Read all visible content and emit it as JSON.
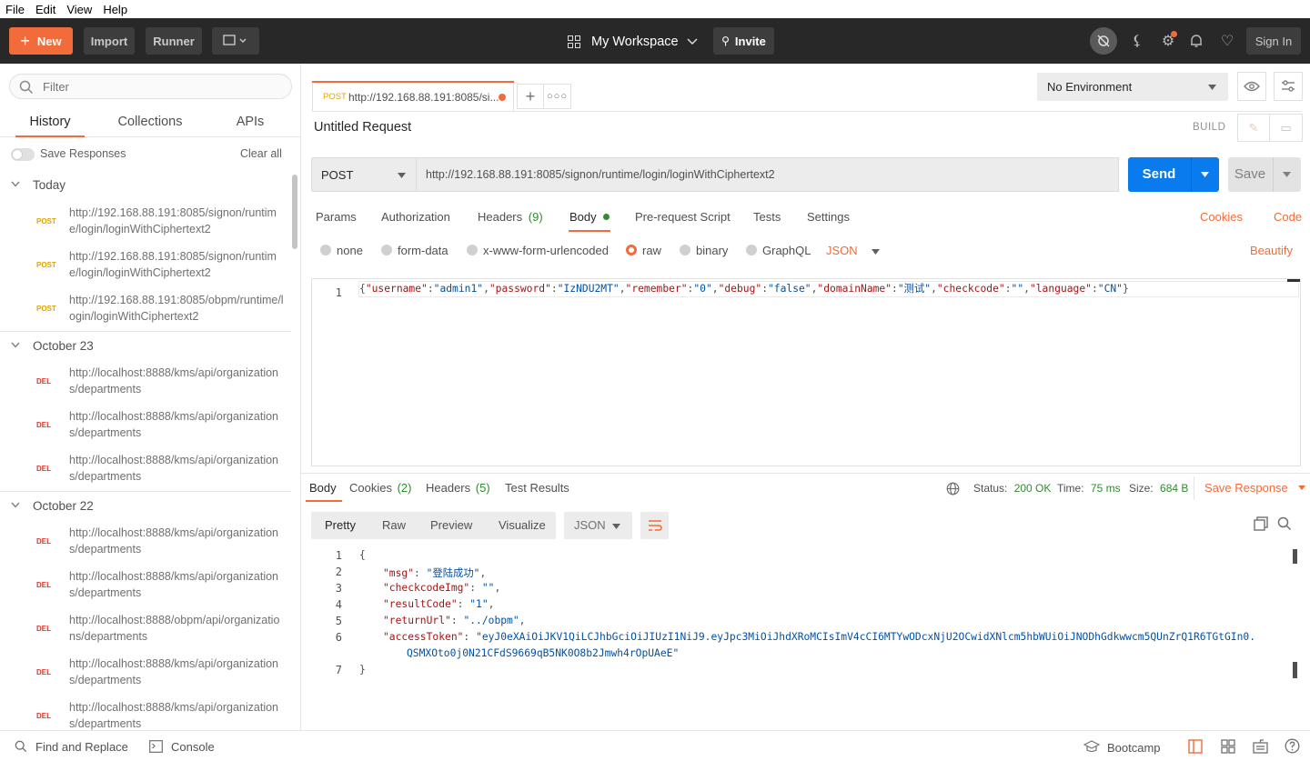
{
  "menu": [
    "File",
    "Edit",
    "View",
    "Help"
  ],
  "header": {
    "new_label": "New",
    "import_label": "Import",
    "runner_label": "Runner",
    "workspace_label": "My Workspace",
    "invite_label": "Invite",
    "signin_label": "Sign In",
    "accent_color": "#f26b3a"
  },
  "sidebar": {
    "filter_placeholder": "Filter",
    "tabs": [
      "History",
      "Collections",
      "APIs"
    ],
    "active_tab": "History",
    "save_responses_label": "Save Responses",
    "clear_all_label": "Clear all",
    "groups": [
      {
        "title": "Today",
        "items": [
          {
            "method": "POST",
            "url": "http://192.168.88.191:8085/signon/runtime/login/loginWithCiphertext2"
          },
          {
            "method": "POST",
            "url": "http://192.168.88.191:8085/signon/runtime/login/loginWithCiphertext2"
          },
          {
            "method": "POST",
            "url": "http://192.168.88.191:8085/obpm/runtime/login/loginWithCiphertext2"
          }
        ]
      },
      {
        "title": "October 23",
        "items": [
          {
            "method": "DEL",
            "url": "http://localhost:8888/kms/api/organizations/departments"
          },
          {
            "method": "DEL",
            "url": "http://localhost:8888/kms/api/organizations/departments"
          },
          {
            "method": "DEL",
            "url": "http://localhost:8888/kms/api/organizations/departments"
          }
        ]
      },
      {
        "title": "October 22",
        "items": [
          {
            "method": "DEL",
            "url": "http://localhost:8888/kms/api/organizations/departments"
          },
          {
            "method": "DEL",
            "url": "http://localhost:8888/kms/api/organizations/departments"
          },
          {
            "method": "DEL",
            "url": "http://localhost:8888/obpm/api/organizations/departments"
          },
          {
            "method": "DEL",
            "url": "http://localhost:8888/kms/api/organizations/departments"
          },
          {
            "method": "DEL",
            "url": "http://localhost:8888/kms/api/organizations/departments"
          }
        ]
      }
    ]
  },
  "request_tab": {
    "method": "POST",
    "label": "http://192.168.88.191:8085/si..."
  },
  "environment": {
    "selected": "No Environment"
  },
  "request": {
    "title": "Untitled Request",
    "build_label": "BUILD",
    "method": "POST",
    "url": "http://192.168.88.191:8085/signon/runtime/login/loginWithCiphertext2",
    "send_label": "Send",
    "save_label": "Save",
    "tabs": {
      "params": "Params",
      "authorization": "Authorization",
      "headers": "Headers",
      "headers_count": "(9)",
      "body": "Body",
      "prerequest": "Pre-request Script",
      "tests": "Tests",
      "settings": "Settings"
    },
    "cookies_label": "Cookies",
    "code_label": "Code",
    "body_types": [
      "none",
      "form-data",
      "x-www-form-urlencoded",
      "raw",
      "binary",
      "GraphQL"
    ],
    "selected_body_type": "raw",
    "format": "JSON",
    "beautify_label": "Beautify",
    "body_line_number": "1",
    "body_raw": [
      {
        "t": "p",
        "v": "{"
      },
      {
        "t": "k",
        "v": "\"username\""
      },
      {
        "t": "p",
        "v": ":"
      },
      {
        "t": "s",
        "v": "\"admin1\""
      },
      {
        "t": "p",
        "v": ","
      },
      {
        "t": "k",
        "v": "\"password\""
      },
      {
        "t": "p",
        "v": ":"
      },
      {
        "t": "s",
        "v": "\"IzNDU2MT\""
      },
      {
        "t": "p",
        "v": ","
      },
      {
        "t": "k",
        "v": "\"remember\""
      },
      {
        "t": "p",
        "v": ":"
      },
      {
        "t": "s",
        "v": "\"0\""
      },
      {
        "t": "p",
        "v": ","
      },
      {
        "t": "k",
        "v": "\"debug\""
      },
      {
        "t": "p",
        "v": ":"
      },
      {
        "t": "s",
        "v": "\"false\""
      },
      {
        "t": "p",
        "v": ","
      },
      {
        "t": "k",
        "v": "\"domainName\""
      },
      {
        "t": "p",
        "v": ":"
      },
      {
        "t": "s",
        "v": "\"测试\""
      },
      {
        "t": "p",
        "v": ","
      },
      {
        "t": "k",
        "v": "\"checkcode\""
      },
      {
        "t": "p",
        "v": ":"
      },
      {
        "t": "s",
        "v": "\"\""
      },
      {
        "t": "p",
        "v": ","
      },
      {
        "t": "k",
        "v": "\"language\""
      },
      {
        "t": "p",
        "v": ":"
      },
      {
        "t": "s",
        "v": "\"CN\""
      },
      {
        "t": "p",
        "v": "}"
      }
    ]
  },
  "response": {
    "tabs": {
      "body": "Body",
      "cookies": "Cookies",
      "cookies_count": "(2)",
      "headers": "Headers",
      "headers_count": "(5)",
      "test_results": "Test Results"
    },
    "status_label": "Status:",
    "status_value": "200 OK",
    "time_label": "Time:",
    "time_value": "75 ms",
    "size_label": "Size:",
    "size_value": "684 B",
    "save_response_label": "Save Response",
    "views": [
      "Pretty",
      "Raw",
      "Preview",
      "Visualize"
    ],
    "format": "JSON",
    "line_numbers": [
      "1",
      "2",
      "3",
      "4",
      "5",
      "6",
      "7"
    ],
    "lines": [
      {
        "key": "",
        "value": "",
        "text": "{"
      },
      {
        "key": "\"msg\"",
        "value": "\"登陆成功\"",
        "comma": ","
      },
      {
        "key": "\"checkcodeImg\"",
        "value": "\"\"",
        "comma": ","
      },
      {
        "key": "\"resultCode\"",
        "value": "\"1\"",
        "comma": ","
      },
      {
        "key": "\"returnUrl\"",
        "value": "\"../obpm\"",
        "comma": ","
      },
      {
        "key": "\"accessToken\"",
        "value": "\"eyJ0eXAiOiJKV1QiLCJhbGciOiJIUzI1NiJ9.eyJpc3MiOiJhdXRoMCIsImV4cCI6MTYwODcxNjU2OCwidXNlcm5hbWUiOiJNODhGdkwwcm5QUnZrQ1R6TGtGIn0.",
        "value_cont": "QSMXOto0j0N21CFdS9669qB5NK0O8b2Jmwh4rOpUAeE\"",
        "comma": ""
      },
      {
        "key": "",
        "value": "",
        "text": "}"
      }
    ],
    "status_color": "#2f8c2f"
  },
  "footer": {
    "find_replace": "Find and Replace",
    "console": "Console",
    "bootcamp": "Bootcamp"
  }
}
